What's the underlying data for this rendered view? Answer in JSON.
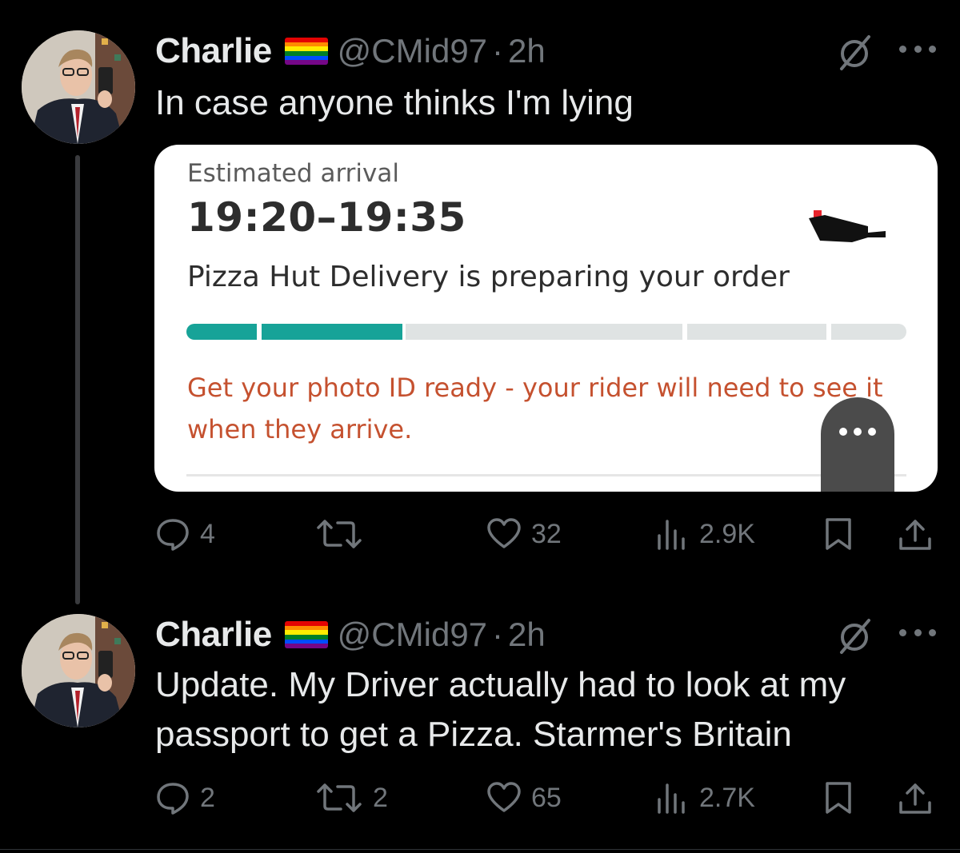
{
  "tweets": [
    {
      "author_name": "Charlie",
      "flag_icon": "pride-flag-icon",
      "handle": "@CMid97",
      "separator": "·",
      "time": "2h",
      "text": "In case anyone thinks I'm lying",
      "card": {
        "estimated_label": "Estimated arrival",
        "eta": "19:20–19:35",
        "status": "Pizza Hut Delivery is preparing your order",
        "progress_segments_total": 5,
        "progress_segments_complete": 2,
        "note": "Get your photo ID ready - your rider will need to see it when they arrive.",
        "accent_color": "#17a398",
        "note_color": "#c5512f"
      },
      "actions": {
        "replies": "4",
        "retweets": "",
        "likes": "32",
        "views": "2.9K"
      }
    },
    {
      "author_name": "Charlie",
      "flag_icon": "pride-flag-icon",
      "handle": "@CMid97",
      "separator": "·",
      "time": "2h",
      "text": "Update. My Driver actually had to look at my passport to get a Pizza. Starmer's Britain",
      "actions": {
        "replies": "2",
        "retweets": "2",
        "likes": "65",
        "views": "2.7K"
      }
    }
  ],
  "colors": {
    "background": "#000000",
    "text_primary": "#e7e9ea",
    "text_secondary": "#71767b"
  }
}
